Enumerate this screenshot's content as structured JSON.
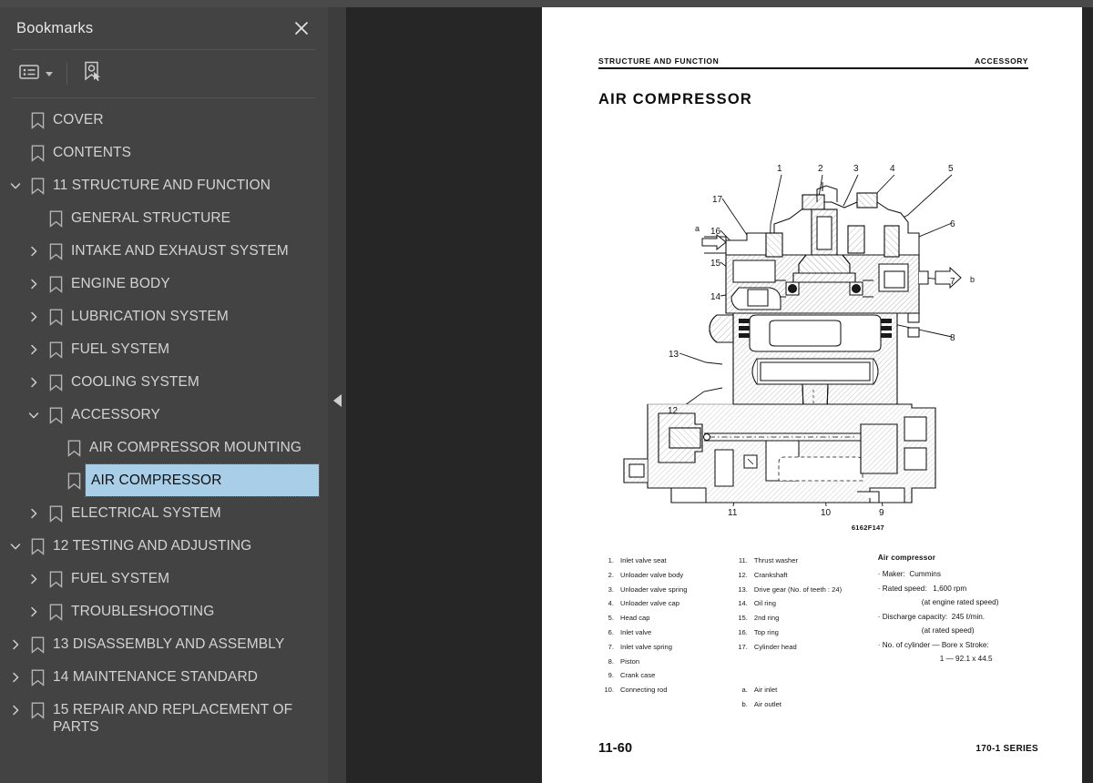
{
  "sidebar": {
    "title": "Bookmarks",
    "close_icon": "close-icon",
    "toolbar": {
      "list_options_icon": "bookmark-list-options-icon",
      "dropdown_icon": "chevron-down-icon",
      "new_bookmark_icon": "new-bookmark-icon"
    },
    "items": [
      {
        "label": "COVER",
        "depth": 0,
        "twisty": "none",
        "selected": false
      },
      {
        "label": "CONTENTS",
        "depth": 0,
        "twisty": "none",
        "selected": false
      },
      {
        "label": "11 STRUCTURE AND FUNCTION",
        "depth": 0,
        "twisty": "expanded",
        "selected": false
      },
      {
        "label": "GENERAL STRUCTURE",
        "depth": 1,
        "twisty": "none",
        "selected": false
      },
      {
        "label": "INTAKE AND EXHAUST SYSTEM",
        "depth": 1,
        "twisty": "collapsed",
        "selected": false
      },
      {
        "label": "ENGINE BODY",
        "depth": 1,
        "twisty": "collapsed",
        "selected": false
      },
      {
        "label": "LUBRICATION SYSTEM",
        "depth": 1,
        "twisty": "collapsed",
        "selected": false
      },
      {
        "label": "FUEL SYSTEM",
        "depth": 1,
        "twisty": "collapsed",
        "selected": false
      },
      {
        "label": "COOLING SYSTEM",
        "depth": 1,
        "twisty": "collapsed",
        "selected": false
      },
      {
        "label": "ACCESSORY",
        "depth": 1,
        "twisty": "expanded",
        "selected": false
      },
      {
        "label": "AIR COMPRESSOR MOUNTING",
        "depth": 2,
        "twisty": "none",
        "selected": false
      },
      {
        "label": "AIR COMPRESSOR",
        "depth": 2,
        "twisty": "none",
        "selected": true
      },
      {
        "label": "ELECTRICAL SYSTEM",
        "depth": 1,
        "twisty": "collapsed",
        "selected": false
      },
      {
        "label": "12 TESTING AND ADJUSTING",
        "depth": 0,
        "twisty": "expanded",
        "selected": false
      },
      {
        "label": "FUEL SYSTEM",
        "depth": 1,
        "twisty": "collapsed",
        "selected": false
      },
      {
        "label": "TROUBLESHOOTING",
        "depth": 1,
        "twisty": "collapsed",
        "selected": false
      },
      {
        "label": "13 DISASSEMBLY AND ASSEMBLY",
        "depth": 0,
        "twisty": "collapsed",
        "selected": false
      },
      {
        "label": "14 MAINTENANCE STANDARD",
        "depth": 0,
        "twisty": "collapsed",
        "selected": false
      },
      {
        "label": "15 REPAIR AND REPLACEMENT OF PARTS",
        "depth": 0,
        "twisty": "collapsed",
        "selected": false
      }
    ],
    "colors": {
      "panel": "#434343",
      "selection": "#a9cfe8",
      "text": "#d3d3d3"
    }
  },
  "splitter": {
    "collapse_icon": "collapse-left-triangle-icon"
  },
  "document": {
    "header_left": "STRUCTURE AND FUNCTION",
    "header_right": "ACCESSORY",
    "title": "AIR COMPRESSOR",
    "figure_number": "6162F147",
    "figure_callouts": [
      "1",
      "2",
      "3",
      "4",
      "5",
      "6",
      "7",
      "8",
      "9",
      "10",
      "11",
      "12",
      "13",
      "14",
      "15",
      "16",
      "17",
      "a",
      "b"
    ],
    "legend_col1": [
      {
        "n": "1.",
        "t": "Inlet valve seat"
      },
      {
        "n": "2.",
        "t": "Unloader valve body"
      },
      {
        "n": "3.",
        "t": "Unloader valve spring"
      },
      {
        "n": "4.",
        "t": "Unloader valve cap"
      },
      {
        "n": "5.",
        "t": "Head cap"
      },
      {
        "n": "6.",
        "t": "Inlet valve"
      },
      {
        "n": "7.",
        "t": "Inlet valve spring"
      },
      {
        "n": "8.",
        "t": "Piston"
      },
      {
        "n": "9.",
        "t": "Crank case"
      },
      {
        "n": "10.",
        "t": "Connecting rod"
      }
    ],
    "legend_col2": [
      {
        "n": "11.",
        "t": "Thrust washer"
      },
      {
        "n": "12.",
        "t": "Crankshaft"
      },
      {
        "n": "13.",
        "t": "Drive gear (No. of teeth :  24)"
      },
      {
        "n": "14.",
        "t": "Oil ring"
      },
      {
        "n": "15.",
        "t": "2nd ring"
      },
      {
        "n": "16.",
        "t": "Top ring"
      },
      {
        "n": "17.",
        "t": "Cylinder head"
      }
    ],
    "legend_col2b": [
      {
        "n": "a.",
        "t": "Air inlet"
      },
      {
        "n": "b.",
        "t": "Air outlet"
      }
    ],
    "spec_title": "Air compressor",
    "spec_rows": [
      {
        "text": "· Maker:  Cummins",
        "indent": 0
      },
      {
        "text": "· Rated speed:   1,600 rpm",
        "indent": 0
      },
      {
        "text": "(at engine rated speed)",
        "indent": 1
      },
      {
        "text": "· Discharge capacity:  245 ℓ/min.",
        "indent": 0
      },
      {
        "text": "(at rated speed)",
        "indent": 1
      },
      {
        "text": "· No. of cylinder — Bore x Stroke:",
        "indent": 0
      },
      {
        "text": "1 — 92.1 x 44.5",
        "indent": 2
      }
    ],
    "page_number": "11-60",
    "series": "170-1 SERIES"
  }
}
